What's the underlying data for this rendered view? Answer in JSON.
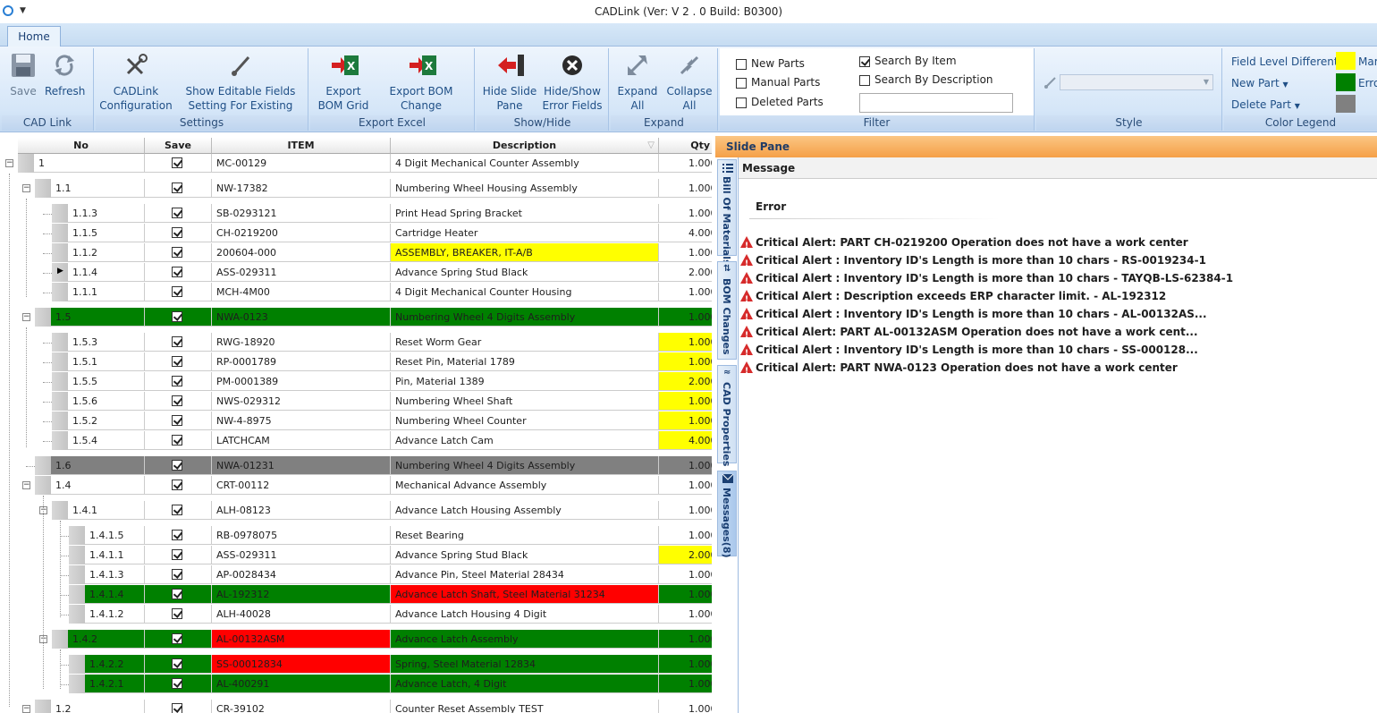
{
  "window": {
    "title": "CADLink (Ver: V 2 . 0 Build: B0300)"
  },
  "tabs": [
    {
      "label": "Home"
    }
  ],
  "ribbon": {
    "cad_link": {
      "label": "CAD Link",
      "save": "Save",
      "refresh": "Refresh"
    },
    "settings": {
      "label": "Settings",
      "config_line1": "CADLink",
      "config_line2": "Configuration",
      "editable_line1": "Show Editable Fields",
      "editable_line2": "Setting For Existing Item"
    },
    "export_excel": {
      "label": "Export Excel",
      "bom_line1": "Export",
      "bom_line2": "BOM Grid",
      "summary_line1": "Export BOM",
      "summary_line2": "Change Summary"
    },
    "show_hide": {
      "label": "Show/Hide",
      "slide_line1": "Hide Slide",
      "slide_line2": "Pane",
      "err_line1": "Hide/Show",
      "err_line2": "Error Fields"
    },
    "expand": {
      "label": "Expand",
      "expand_line1": "Expand",
      "expand_line2": "All",
      "collapse_line1": "Collapse",
      "collapse_line2": "All"
    },
    "filter": {
      "label": "Filter",
      "new_parts": "New Parts",
      "manual_parts": "Manual Parts",
      "deleted_parts": "Deleted Parts",
      "search_item": "Search By Item",
      "search_desc": "Search By Description",
      "search_value": ""
    },
    "style": {
      "label": "Style"
    },
    "color_legend": {
      "label": "Color Legend",
      "field_level": "Field Level Different",
      "new_part": "New Part",
      "delete_part": "Delete Part",
      "legend1": "Mar",
      "legend2": "Erro",
      "colors": {
        "yellow": "#ffff00",
        "green": "#008000",
        "gray": "#808080"
      }
    }
  },
  "grid": {
    "columns": {
      "no": "No",
      "save": "Save",
      "item": "ITEM",
      "description": "Description",
      "qty": "Qty"
    },
    "rows": [
      {
        "no": "1",
        "item": "MC-00129",
        "desc": "4 Digit Mechanical Counter Assembly",
        "qty": "1.000"
      },
      {
        "no": "1.1",
        "item": "NW-17382",
        "desc": "Numbering Wheel Housing Assembly",
        "qty": "1.000"
      },
      {
        "no": "1.1.3",
        "item": "SB-0293121",
        "desc": "Print Head Spring Bracket",
        "qty": "1.000"
      },
      {
        "no": "1.1.5",
        "item": "CH-0219200",
        "desc": "Cartridge Heater",
        "qty": "4.000"
      },
      {
        "no": "1.1.2",
        "item": "200604-000",
        "desc": "ASSEMBLY, BREAKER, IT-A/B",
        "qty": "1.000"
      },
      {
        "no": "1.1.4",
        "item": "ASS-029311",
        "desc": "Advance Spring Stud Black",
        "qty": "2.000"
      },
      {
        "no": "1.1.1",
        "item": "MCH-4M00",
        "desc": "4 Digit Mechanical Counter Housing",
        "qty": "1.000"
      },
      {
        "no": "1.5",
        "item": "NWA-0123",
        "desc": "Numbering Wheel 4 Digits Assembly",
        "qty": "1.000"
      },
      {
        "no": "1.5.3",
        "item": "RWG-18920",
        "desc": "Reset Worm Gear",
        "qty": "1.000"
      },
      {
        "no": "1.5.1",
        "item": "RP-0001789",
        "desc": "Reset Pin, Material 1789",
        "qty": "1.000"
      },
      {
        "no": "1.5.5",
        "item": "PM-0001389",
        "desc": "Pin, Material 1389",
        "qty": "2.000"
      },
      {
        "no": "1.5.6",
        "item": "NWS-029312",
        "desc": "Numbering Wheel Shaft",
        "qty": "1.000"
      },
      {
        "no": "1.5.2",
        "item": "NW-4-8975",
        "desc": "Numbering Wheel Counter",
        "qty": "1.000"
      },
      {
        "no": "1.5.4",
        "item": "LATCHCAM",
        "desc": "Advance Latch Cam",
        "qty": "4.000"
      },
      {
        "no": "1.6",
        "item": "NWA-01231",
        "desc": "Numbering Wheel 4 Digits Assembly",
        "qty": "1.000"
      },
      {
        "no": "1.4",
        "item": "CRT-00112",
        "desc": "Mechanical Advance Assembly",
        "qty": "1.000"
      },
      {
        "no": "1.4.1",
        "item": "ALH-08123",
        "desc": "Advance Latch Housing Assembly",
        "qty": "1.000"
      },
      {
        "no": "1.4.1.5",
        "item": "RB-0978075",
        "desc": "Reset Bearing",
        "qty": "1.000"
      },
      {
        "no": "1.4.1.1",
        "item": "ASS-029311",
        "desc": "Advance Spring Stud Black",
        "qty": "2.000"
      },
      {
        "no": "1.4.1.3",
        "item": "AP-0028434",
        "desc": "Advance Pin, Steel Material 28434",
        "qty": "1.000"
      },
      {
        "no": "1.4.1.4",
        "item": "AL-192312",
        "desc": "Advance Latch Shaft, Steel Material 31234",
        "qty": "1.000"
      },
      {
        "no": "1.4.1.2",
        "item": "ALH-40028",
        "desc": "Advance Latch Housing 4 Digit",
        "qty": "1.000"
      },
      {
        "no": "1.4.2",
        "item": "AL-00132ASM",
        "desc": "Advance Latch Assembly",
        "qty": "1.000"
      },
      {
        "no": "1.4.2.2",
        "item": "SS-00012834",
        "desc": "Spring, Steel Material 12834",
        "qty": "1.000"
      },
      {
        "no": "1.4.2.1",
        "item": "AL-400291",
        "desc": "Advance Latch, 4 Digit",
        "qty": "1.000"
      },
      {
        "no": "1.2",
        "item": "CR-39102",
        "desc": "Counter Reset Assembly TEST",
        "qty": "1.000"
      }
    ]
  },
  "slide_pane": {
    "title": "Slide Pane",
    "tabs": [
      {
        "label": "Bill Of Materials"
      },
      {
        "label": "BOM Changes"
      },
      {
        "label": "CAD Properties"
      },
      {
        "label": "Messages(8)"
      }
    ],
    "message_header": "Message",
    "error_header": "Error",
    "alerts": [
      "Critical Alert: PART CH-0219200  Operation does not have a work center",
      "Critical Alert : Inventory ID's Length is more than 10 chars - RS-0019234-1",
      "Critical Alert : Inventory ID's Length is more than 10 chars - TAYQB-LS-62384-1",
      "Critical Alert : Description exceeds ERP character limit.  - AL-192312",
      "Critical Alert :  Inventory  ID's  Length  is  more  than  10  chars  -  AL-00132AS...",
      "Critical Alert: PART AL-00132ASM  Operation does not have a work cent...",
      "Critical Alert :  Inventory  ID's  Length  is  more  than  10  chars  -  SS-000128...",
      "Critical Alert: PART NWA-0123  Operation does not have a work center"
    ]
  }
}
